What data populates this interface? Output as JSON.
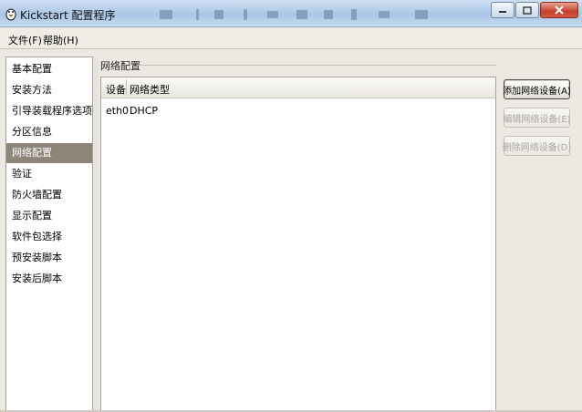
{
  "window": {
    "title": "Kickstart 配置程序"
  },
  "menu": {
    "file": "文件(F)",
    "help": "帮助(H)"
  },
  "sidebar": {
    "items": [
      {
        "label": "基本配置"
      },
      {
        "label": "安装方法"
      },
      {
        "label": "引导装载程序选项"
      },
      {
        "label": "分区信息"
      },
      {
        "label": "网络配置",
        "selected": true
      },
      {
        "label": "验证"
      },
      {
        "label": "防火墙配置"
      },
      {
        "label": "显示配置"
      },
      {
        "label": "软件包选择"
      },
      {
        "label": "预安装脚本"
      },
      {
        "label": "安装后脚本"
      }
    ]
  },
  "network": {
    "section_title": "网络配置",
    "columns": [
      "设备",
      "网络类型"
    ],
    "rows": [
      {
        "device": "eth0",
        "type": "DHCP"
      }
    ],
    "buttons": {
      "add": "添加网络设备(A)",
      "edit": "编辑网络设备(E)",
      "delete": "删除网络设备(D)"
    }
  },
  "colors": {
    "selection": "#8d8578",
    "titlebar": "#a9c6e6",
    "close": "#c4402b"
  }
}
